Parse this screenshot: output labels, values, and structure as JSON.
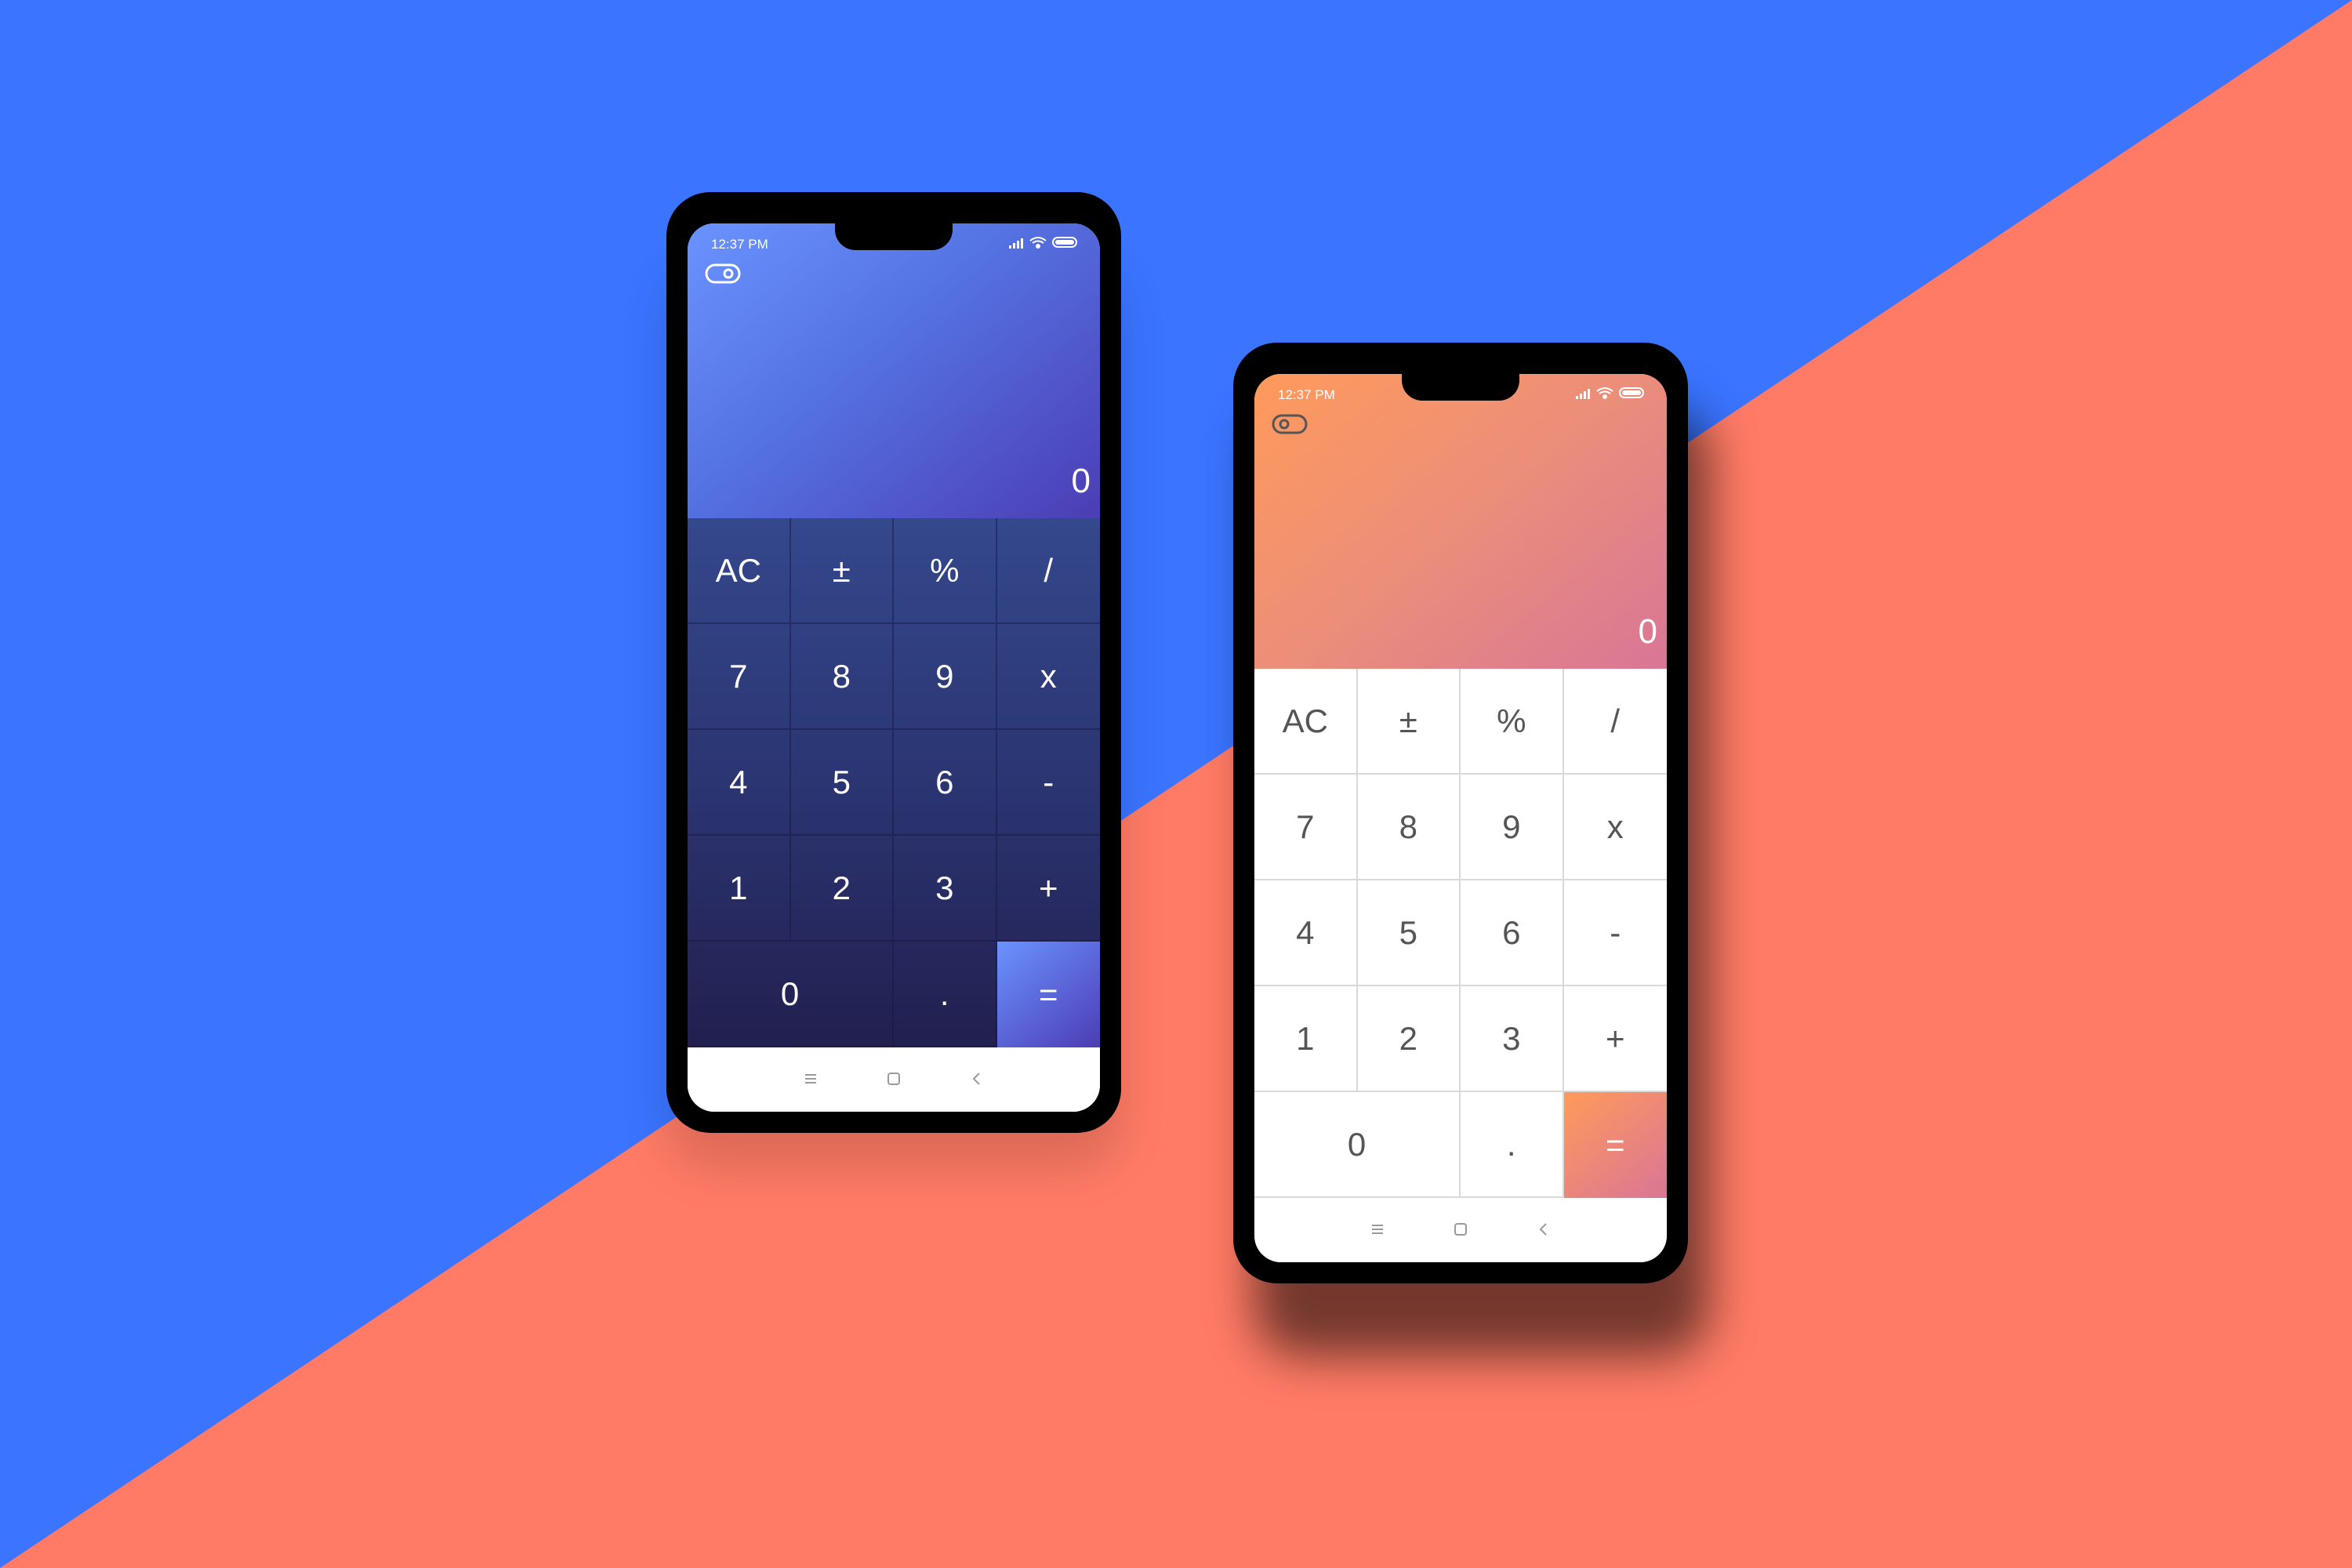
{
  "background": {
    "colors": {
      "blue": "#3a74ff",
      "coral": "#ff7b65"
    }
  },
  "phones": [
    {
      "theme": "dark",
      "status_time": "12:37 PM",
      "display_value": "0",
      "icons": {
        "toggle": "toggle-icon",
        "signal": "signal-icon",
        "wifi": "wifi-icon",
        "battery": "battery-icon"
      },
      "keys": [
        "AC",
        "±",
        "%",
        "/",
        "7",
        "8",
        "9",
        "x",
        "4",
        "5",
        "6",
        "-",
        "1",
        "2",
        "3",
        "+",
        "0",
        ".",
        "="
      ],
      "nav": [
        "menu-icon",
        "home-icon",
        "back-icon"
      ],
      "colors": {
        "accent_start": "#6a93ff",
        "accent_end": "#4c3db4",
        "keypad": "#2b3572"
      }
    },
    {
      "theme": "light",
      "status_time": "12:37 PM",
      "display_value": "0",
      "icons": {
        "toggle": "toggle-icon",
        "signal": "signal-icon",
        "wifi": "wifi-icon",
        "battery": "battery-icon"
      },
      "keys": [
        "AC",
        "±",
        "%",
        "/",
        "7",
        "8",
        "9",
        "x",
        "4",
        "5",
        "6",
        "-",
        "1",
        "2",
        "3",
        "+",
        "0",
        ".",
        "="
      ],
      "nav": [
        "menu-icon",
        "home-icon",
        "back-icon"
      ],
      "colors": {
        "accent_start": "#ff9a5b",
        "accent_end": "#d97696",
        "keypad": "#ffffff"
      }
    }
  ]
}
